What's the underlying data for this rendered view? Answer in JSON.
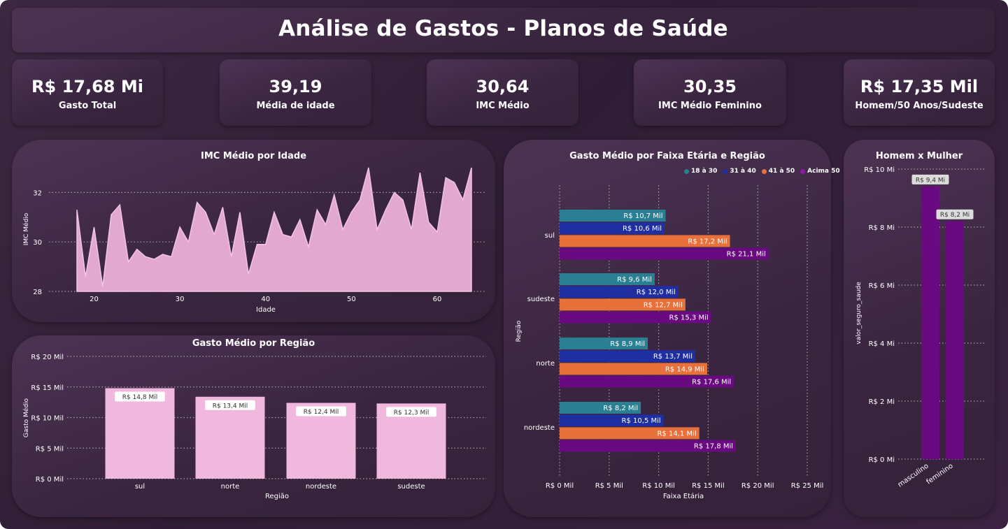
{
  "header": {
    "title": "Análise de Gastos - Planos de Saúde"
  },
  "kpis": [
    {
      "value": "R$ 17,68 Mi",
      "label": "Gasto Total"
    },
    {
      "value": "39,19",
      "label": "Média de idade"
    },
    {
      "value": "30,64",
      "label": "IMC Médio"
    },
    {
      "value": "30,35",
      "label": "IMC Médio Feminino"
    },
    {
      "value": "R$ 17,35 Mil",
      "label": "Homem/50 Anos/Sudeste"
    }
  ],
  "colors": {
    "area_fill": "#e3a8d0",
    "bar_pink": "#f1b8dd",
    "s18_30": "#2a7f92",
    "s31_40": "#1f2ea0",
    "s41_50": "#e8703a",
    "s50p": "#6a0a80",
    "gender_bar": "#6a0a80"
  },
  "chart_data": [
    {
      "id": "imc_age",
      "type": "area",
      "title": "IMC Médio por Idade",
      "xlabel": "Idade",
      "ylabel": "IMC Médio",
      "xlim": [
        18,
        64
      ],
      "ylim": [
        28,
        33
      ],
      "x_ticks": [
        "20",
        "30",
        "40",
        "50",
        "60"
      ],
      "y_ticks": [
        "28",
        "30",
        "32"
      ],
      "x": [
        18,
        19,
        20,
        21,
        22,
        23,
        24,
        25,
        26,
        27,
        28,
        29,
        30,
        31,
        32,
        33,
        34,
        35,
        36,
        37,
        38,
        39,
        40,
        41,
        42,
        43,
        44,
        45,
        46,
        47,
        48,
        49,
        50,
        51,
        52,
        53,
        54,
        55,
        56,
        57,
        58,
        59,
        60,
        61,
        62,
        63,
        64
      ],
      "y": [
        31.3,
        28.6,
        30.6,
        28.2,
        31.1,
        31.5,
        29.2,
        29.7,
        29.4,
        29.3,
        29.5,
        29.4,
        30.6,
        30.0,
        31.6,
        31.2,
        30.3,
        31.4,
        29.4,
        31.2,
        28.7,
        29.9,
        29.9,
        31.2,
        30.3,
        30.2,
        30.9,
        29.8,
        31.3,
        30.7,
        31.9,
        30.5,
        31.2,
        31.7,
        33.0,
        30.5,
        31.3,
        32.0,
        31.7,
        30.5,
        32.8,
        30.8,
        30.4,
        32.6,
        32.4,
        31.7,
        33.0
      ]
    },
    {
      "id": "gasto_regiao",
      "type": "bar",
      "title": "Gasto Médio por Região",
      "xlabel": "Região",
      "ylabel": "Gasto Médio",
      "ylim": [
        0,
        20
      ],
      "y_ticks": [
        "R$ 0 Mil",
        "R$ 5 Mil",
        "R$ 10 Mil",
        "R$ 15 Mil",
        "R$ 20 Mil"
      ],
      "categories": [
        "sul",
        "norte",
        "nordeste",
        "sudeste"
      ],
      "values": [
        14.8,
        13.4,
        12.4,
        12.3
      ],
      "data_labels": [
        "R$ 14,8 Mil",
        "R$ 13,4 Mil",
        "R$ 12,4 Mil",
        "R$ 12,3 Mil"
      ]
    },
    {
      "id": "gasto_faixa_regiao",
      "type": "bar",
      "orientation": "horizontal",
      "title": "Gasto Médio por Faixa Etária e Região",
      "xlabel": "Faixa Etária",
      "ylabel": "Região",
      "xlim": [
        0,
        25
      ],
      "x_ticks": [
        "R$ 0 Mil",
        "R$ 5 Mil",
        "R$ 10 Mil",
        "R$ 15 Mil",
        "R$ 20 Mil",
        "R$ 25 Mil"
      ],
      "legend_position": "top-right",
      "categories": [
        "sul",
        "sudeste",
        "norte",
        "nordeste"
      ],
      "series": [
        {
          "name": "18 à 30",
          "color_key": "s18_30",
          "values": [
            10.7,
            9.6,
            8.9,
            8.2
          ],
          "labels": [
            "R$ 10,7 Mil",
            "R$ 9,6 Mil",
            "R$ 8,9 Mil",
            "R$ 8,2 Mil"
          ]
        },
        {
          "name": "31 à 40",
          "color_key": "s31_40",
          "values": [
            10.6,
            12.0,
            13.7,
            10.5
          ],
          "labels": [
            "R$ 10,6 Mil",
            "R$ 12,0 Mil",
            "R$ 13,7 Mil",
            "R$ 10,5 Mil"
          ]
        },
        {
          "name": "41 à 50",
          "color_key": "s41_50",
          "values": [
            17.2,
            12.7,
            14.9,
            14.1
          ],
          "labels": [
            "R$ 17,2 Mil",
            "R$ 12,7 Mil",
            "R$ 14,9 Mil",
            "R$ 14,1 Mil"
          ]
        },
        {
          "name": "Acima 50",
          "color_key": "s50p",
          "values": [
            21.1,
            15.3,
            17.6,
            17.8
          ],
          "labels": [
            "R$ 21,1 Mil",
            "R$ 15,3 Mil",
            "R$ 17,6 Mil",
            "R$ 17,8 Mil"
          ]
        }
      ]
    },
    {
      "id": "homem_mulher",
      "type": "bar",
      "title": "Homem x Mulher",
      "ylabel": "valor_seguro_saude",
      "ylim": [
        0,
        10
      ],
      "y_ticks": [
        "R$ 0 Mi",
        "R$ 2 Mi",
        "R$ 4 Mi",
        "R$ 6 Mi",
        "R$ 8 Mi",
        "R$ 10 Mi"
      ],
      "categories": [
        "masculino",
        "feminino"
      ],
      "values": [
        9.4,
        8.2
      ],
      "data_labels": [
        "R$ 9,4 Mi",
        "R$ 8,2 Mi"
      ]
    }
  ]
}
